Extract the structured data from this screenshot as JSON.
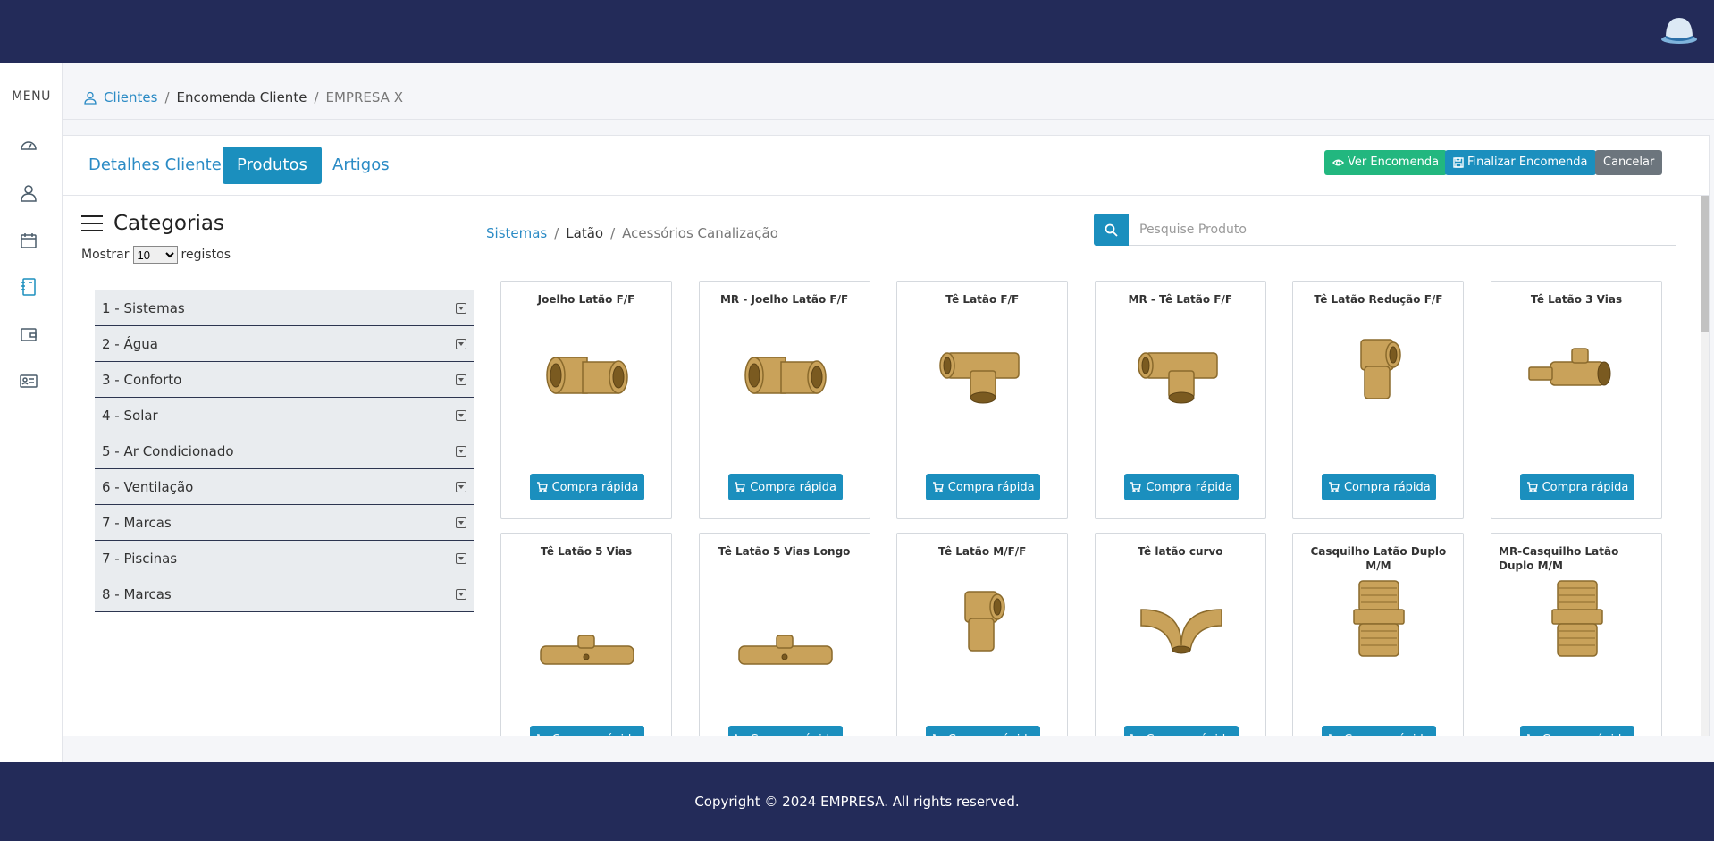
{
  "sidebar": {
    "menu_label": "MENU"
  },
  "breadcrumb": {
    "clients": "Clientes",
    "order": "Encomenda Cliente",
    "company": "EMPRESA X"
  },
  "tabs": {
    "details": "Detalhes Cliente",
    "products": "Produtos",
    "articles": "Artigos"
  },
  "actions": {
    "view_order": "Ver Encomenda",
    "finalize_order": "Finalizar Encomenda",
    "cancel": "Cancelar"
  },
  "categories": {
    "title": "Categorias",
    "show_label": "Mostrar",
    "show_value": "10",
    "records_label": "registos",
    "items": [
      "1 - Sistemas",
      "2 - Água",
      "3 - Conforto",
      "4 - Solar",
      "5 - Ar Condicionado",
      "6 - Ventilação",
      "7 - Marcas",
      "7 - Piscinas",
      "8 - Marcas"
    ]
  },
  "product_breadcrumb": {
    "level1": "Sistemas",
    "level2": "Latão",
    "level3": "Acessórios Canalização"
  },
  "search": {
    "placeholder": "Pesquise Produto"
  },
  "quick_buy_label": "Compra rápida",
  "products": [
    "Joelho Latão F/F",
    "MR - Joelho Latão F/F",
    "Tê Latão F/F",
    "MR - Tê Latão F/F",
    "Tê Latão Redução F/F",
    "Tê Latão 3 Vias",
    "Tê Latão 5 Vias",
    "Tê Latão 5 Vias Longo",
    "Tê Latão M/F/F",
    "Tê latão curvo",
    "Casquilho Latão Duplo M/M",
    "MR-Casquilho Latão Duplo M/M"
  ],
  "footer": {
    "copyright": "Copyright © 2024 EMPRESA. All rights reserved."
  },
  "colors": {
    "navy": "#232b59",
    "primary": "#1b8fbe",
    "success": "#22b77f",
    "secondary": "#6c757d",
    "brass": "#c9a25a"
  }
}
